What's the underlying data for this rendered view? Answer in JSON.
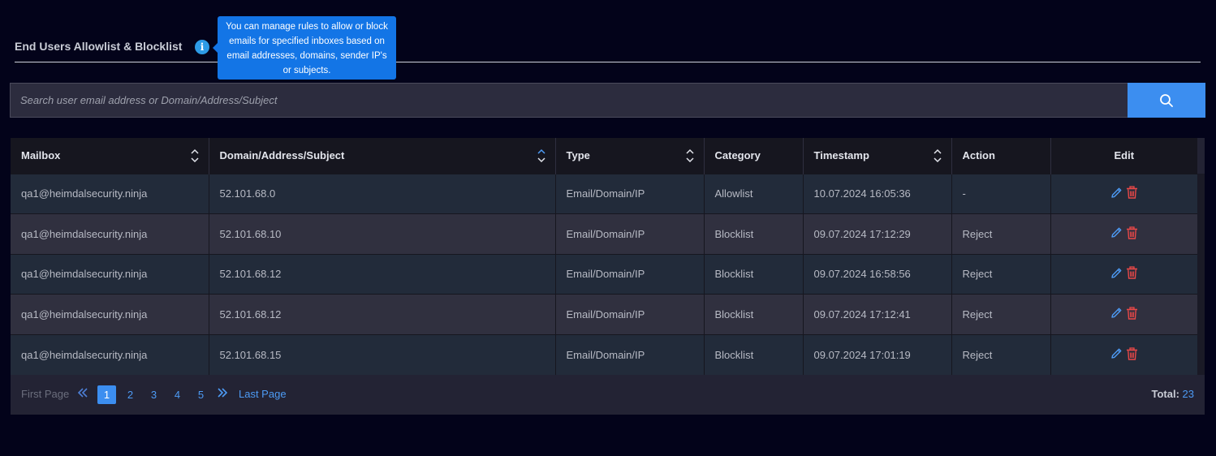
{
  "header": {
    "title": "End Users Allowlist & Blocklist",
    "info_icon": "info-icon",
    "tooltip": "You can manage rules to allow or block emails for specified inboxes based on email addresses, domains, sender IP's or subjects."
  },
  "search": {
    "placeholder": "Search user email address or Domain/Address/Subject",
    "value": "",
    "button_icon": "search-icon"
  },
  "table": {
    "columns": [
      {
        "label": "Mailbox",
        "sortable": true
      },
      {
        "label": "Domain/Address/Subject",
        "sortable": true
      },
      {
        "label": "Type",
        "sortable": true
      },
      {
        "label": "Category",
        "sortable": false
      },
      {
        "label": "Timestamp",
        "sortable": true
      },
      {
        "label": "Action",
        "sortable": false
      },
      {
        "label": "Edit",
        "sortable": false
      }
    ],
    "rows": [
      {
        "mailbox": "qa1@heimdalsecurity.ninja",
        "domain": "52.101.68.0",
        "type": "Email/Domain/IP",
        "category": "Allowlist",
        "timestamp": "10.07.2024  16:05:36",
        "action": "-"
      },
      {
        "mailbox": "qa1@heimdalsecurity.ninja",
        "domain": "52.101.68.10",
        "type": "Email/Domain/IP",
        "category": "Blocklist",
        "timestamp": "09.07.2024  17:12:29",
        "action": "Reject"
      },
      {
        "mailbox": "qa1@heimdalsecurity.ninja",
        "domain": "52.101.68.12",
        "type": "Email/Domain/IP",
        "category": "Blocklist",
        "timestamp": "09.07.2024  16:58:56",
        "action": "Reject"
      },
      {
        "mailbox": "qa1@heimdalsecurity.ninja",
        "domain": "52.101.68.12",
        "type": "Email/Domain/IP",
        "category": "Blocklist",
        "timestamp": "09.07.2024  17:12:41",
        "action": "Reject"
      },
      {
        "mailbox": "qa1@heimdalsecurity.ninja",
        "domain": "52.101.68.15",
        "type": "Email/Domain/IP",
        "category": "Blocklist",
        "timestamp": "09.07.2024  17:01:19",
        "action": "Reject"
      }
    ]
  },
  "pagination": {
    "first_label": "First Page",
    "pages": [
      "1",
      "2",
      "3",
      "4",
      "5"
    ],
    "current_page": "1",
    "last_label": "Last Page",
    "total_label": "Total:",
    "total_value": "23"
  },
  "colors": {
    "background": "#03031a",
    "accent": "#3c8ef0",
    "delete": "#e84848",
    "tooltip": "#1375e6"
  }
}
